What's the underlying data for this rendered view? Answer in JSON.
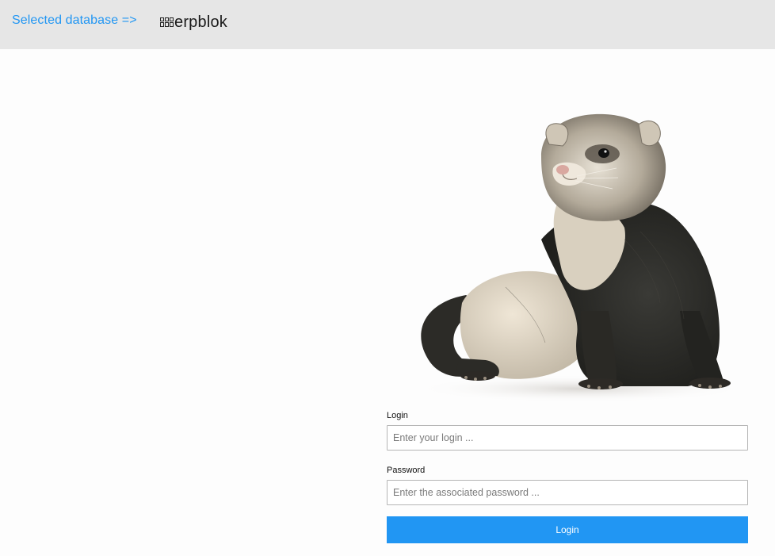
{
  "header": {
    "selected_database_label": "Selected database =>",
    "brand_name": "erpblok",
    "brand_color": "#2196f3"
  },
  "hero": {
    "image": "ferret-photo"
  },
  "login_form": {
    "login_label": "Login",
    "login_placeholder": "Enter your login ...",
    "login_value": "",
    "password_label": "Password",
    "password_placeholder": "Enter the associated password ...",
    "password_value": "",
    "submit_label": "Login",
    "button_color": "#2196f3"
  }
}
